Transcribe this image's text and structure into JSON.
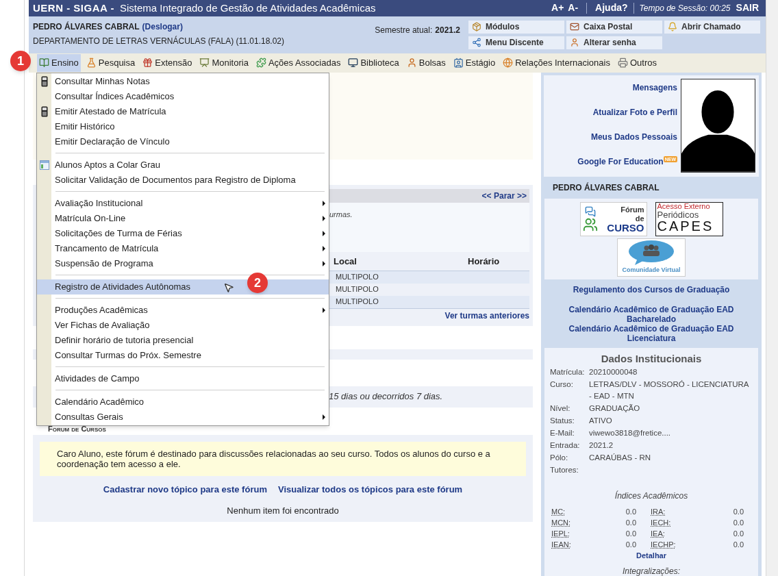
{
  "header": {
    "brand": "UERN - SIGAA -",
    "title": "Sistema Integrado de Gestão de Atividades Acadêmicas",
    "font_up": "A+",
    "font_down": "A-",
    "help": "Ajuda?",
    "session": "Tempo de Sessão: 00:25",
    "logout": "SAIR"
  },
  "user": {
    "name": "PEDRO ÁLVARES CABRAL",
    "logout_link": "(Deslogar)",
    "department": "DEPARTAMENTO DE LETRAS VERNÁCULAS (FALA) (11.01.18.02)",
    "semester_label": "Semestre atual:",
    "semester": "2021.2"
  },
  "quick_buttons": [
    {
      "label": "Módulos"
    },
    {
      "label": "Caixa Postal"
    },
    {
      "label": "Abrir Chamado"
    },
    {
      "label": "Menu Discente"
    },
    {
      "label": "Alterar senha"
    }
  ],
  "menu_bar": [
    {
      "label": "Ensino",
      "selected": true
    },
    {
      "label": "Pesquisa",
      "selected": false
    },
    {
      "label": "Extensão",
      "selected": false
    },
    {
      "label": "Monitoria",
      "selected": false
    },
    {
      "label": "Ações Associadas",
      "selected": false
    },
    {
      "label": "Biblioteca",
      "selected": false
    },
    {
      "label": "Bolsas",
      "selected": false
    },
    {
      "label": "Estágio",
      "selected": false
    },
    {
      "label": "Relações Internacionais",
      "selected": false
    },
    {
      "label": "Outros",
      "selected": false
    }
  ],
  "dropdown": {
    "groups": [
      {
        "items": [
          {
            "label": "Consultar Minhas Notas",
            "kind": "calculator",
            "submenu": false,
            "selected": false
          },
          {
            "label": "Consultar Índices Acadêmicos",
            "kind": "plain",
            "submenu": false,
            "selected": false
          },
          {
            "label": "Emitir Atestado de Matrícula",
            "kind": "calculator",
            "submenu": false,
            "selected": false
          },
          {
            "label": "Emitir Histórico",
            "kind": "plain",
            "submenu": false,
            "selected": false
          },
          {
            "label": "Emitir Declaração de Vínculo",
            "kind": "plain",
            "submenu": false,
            "selected": false
          }
        ]
      },
      {
        "items": [
          {
            "label": "Alunos Aptos a Colar Grau",
            "kind": "table",
            "submenu": false,
            "selected": false
          },
          {
            "label": "Solicitar Validação de Documentos para Registro de Diploma",
            "kind": "plain",
            "submenu": false,
            "selected": false
          }
        ]
      },
      {
        "items": [
          {
            "label": "Avaliação Institucional",
            "kind": "plain",
            "submenu": true,
            "selected": false
          },
          {
            "label": "Matrícula On-Line",
            "kind": "plain",
            "submenu": true,
            "selected": false
          },
          {
            "label": "Solicitações de Turma de Férias",
            "kind": "plain",
            "submenu": true,
            "selected": false
          },
          {
            "label": "Trancamento de Matrícula",
            "kind": "plain",
            "submenu": true,
            "selected": false
          },
          {
            "label": "Suspensão de Programa",
            "kind": "plain",
            "submenu": true,
            "selected": false
          }
        ]
      },
      {
        "items": [
          {
            "label": "Registro de Atividades Autônomas",
            "kind": "plain",
            "submenu": false,
            "selected": true
          }
        ]
      },
      {
        "items": [
          {
            "label": "Produções Acadêmicas",
            "kind": "plain",
            "submenu": true,
            "selected": false
          },
          {
            "label": "Ver Fichas de Avaliação",
            "kind": "plain",
            "submenu": false,
            "selected": false
          },
          {
            "label": "Definir horário de tutoria presencial",
            "kind": "plain",
            "submenu": false,
            "selected": false
          },
          {
            "label": "Consultar Turmas do Próx. Semestre",
            "kind": "plain",
            "submenu": false,
            "selected": false
          }
        ]
      },
      {
        "items": [
          {
            "label": "Atividades de Campo",
            "kind": "plain",
            "submenu": false,
            "selected": false
          }
        ]
      },
      {
        "items": [
          {
            "label": "Calendário Acadêmico",
            "kind": "plain",
            "submenu": false,
            "selected": false
          },
          {
            "label": "Consultas Gerais",
            "kind": "plain",
            "submenu": true,
            "selected": false
          }
        ]
      }
    ]
  },
  "annotations": [
    {
      "label": "1"
    },
    {
      "label": "2"
    }
  ],
  "classes_panel": {
    "nav": "<< Parar >>",
    "note": "urmas.",
    "columns": [
      "Local",
      "Horário"
    ],
    "rows": [
      {
        "local": "MULTIPOLO"
      },
      {
        "local": "MULTIPOLO"
      },
      {
        "local": "MULTIPOLO"
      }
    ],
    "more": "Ver turmas anteriores"
  },
  "notice_fragment": "15 dias ou decorridos 7 dias.",
  "forum": {
    "title": "Forum de Cursos",
    "message": "Caro Aluno, este fórum é destinado para discussões relacionadas ao seu curso. Todos os alunos do curso e a coordenação tem acesso a ele.",
    "links": [
      "Cadastrar novo tópico para este fórum",
      "Visualizar todos os tópicos para este fórum"
    ],
    "empty": "Nenhum item foi encontrado"
  },
  "sidebar": {
    "links": [
      {
        "label": "Mensagens"
      },
      {
        "label": "Atualizar Foto e Perfil"
      },
      {
        "label": "Meus Dados Pessoais"
      },
      {
        "label": "Google For Education",
        "badge": "NEW"
      }
    ],
    "student_name": "PEDRO ÁLVARES CABRAL",
    "banners": [
      {
        "kind": "forum",
        "lines": [
          "Fórum",
          "de",
          "CURSO"
        ]
      },
      {
        "kind": "capes",
        "lines": [
          "Acesso Externo",
          "Periódicos",
          "CAPES"
        ]
      },
      {
        "kind": "community",
        "lines": [
          "Comunidade Virtual"
        ]
      }
    ],
    "documents": [
      "Regulamento dos Cursos de Graduação",
      "Calendário Acadêmico de Graduação EAD Bacharelado",
      "Calendário Acadêmico de Graduação EAD Licenciatura"
    ],
    "institutional": {
      "title": "Dados Institucionais",
      "fields": [
        {
          "label": "Matrícula:",
          "value": "20210000048"
        },
        {
          "label": "Curso:",
          "value": "LETRAS/DLV - MOSSORÓ - LICENCIATURA - EAD - MTN"
        },
        {
          "label": "Nível:",
          "value": "GRADUAÇÃO"
        },
        {
          "label": "Status:",
          "value": "ATIVO"
        },
        {
          "label": "E-Mail:",
          "value": "viwewo3818@fretice...."
        },
        {
          "label": "Entrada:",
          "value": "2021.2"
        },
        {
          "label": "Pólo:",
          "value": "CARAÚBAS - RN"
        },
        {
          "label": "Tutores:"
        }
      ],
      "indices_title": "Índices Acadêmicos",
      "indices": [
        {
          "label": "MC:",
          "value": "0.0"
        },
        {
          "label": "IRA:",
          "value": "0.0"
        },
        {
          "label": "MCN:",
          "value": "0.0"
        },
        {
          "label": "IECH:",
          "value": "0.0"
        },
        {
          "label": "IEPL:",
          "value": "0.0"
        },
        {
          "label": "IEA:",
          "value": "0.0"
        },
        {
          "label": "IEAN:",
          "value": "0.0"
        },
        {
          "label": "IECHP:",
          "value": "0.0"
        }
      ],
      "detail_link": "Detalhar",
      "next_section": "Integralizações:"
    }
  }
}
